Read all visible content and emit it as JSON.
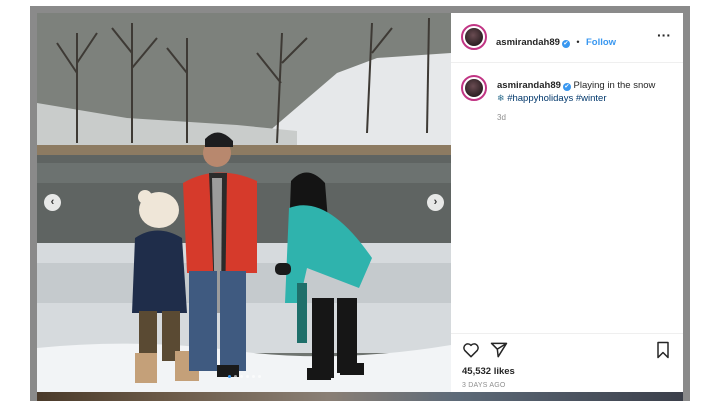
{
  "post": {
    "username": "asmirandah89",
    "verified_mark": "✔",
    "separator": "•",
    "follow_label": "Follow",
    "more_label": "···",
    "caption_text": "Playing in the snow",
    "hashtags": [
      "#happyholidays",
      "#winter"
    ],
    "caption_age": "3d",
    "likes": "45,532 likes",
    "posted_ago": "3 DAYS AGO"
  },
  "carousel": {
    "prev_label": "‹",
    "next_label": "›",
    "dot_count": 6,
    "active_dot": 0
  },
  "icons": {
    "like": "heart-outline-icon",
    "share": "paper-plane-icon",
    "save": "bookmark-icon",
    "more": "ellipsis-icon",
    "snowflake": "snowflake-icon"
  },
  "colors": {
    "accent": "#3897f0",
    "hashtag": "#00376b",
    "story_ring": "#c13584",
    "muted": "#8e8e8e"
  }
}
